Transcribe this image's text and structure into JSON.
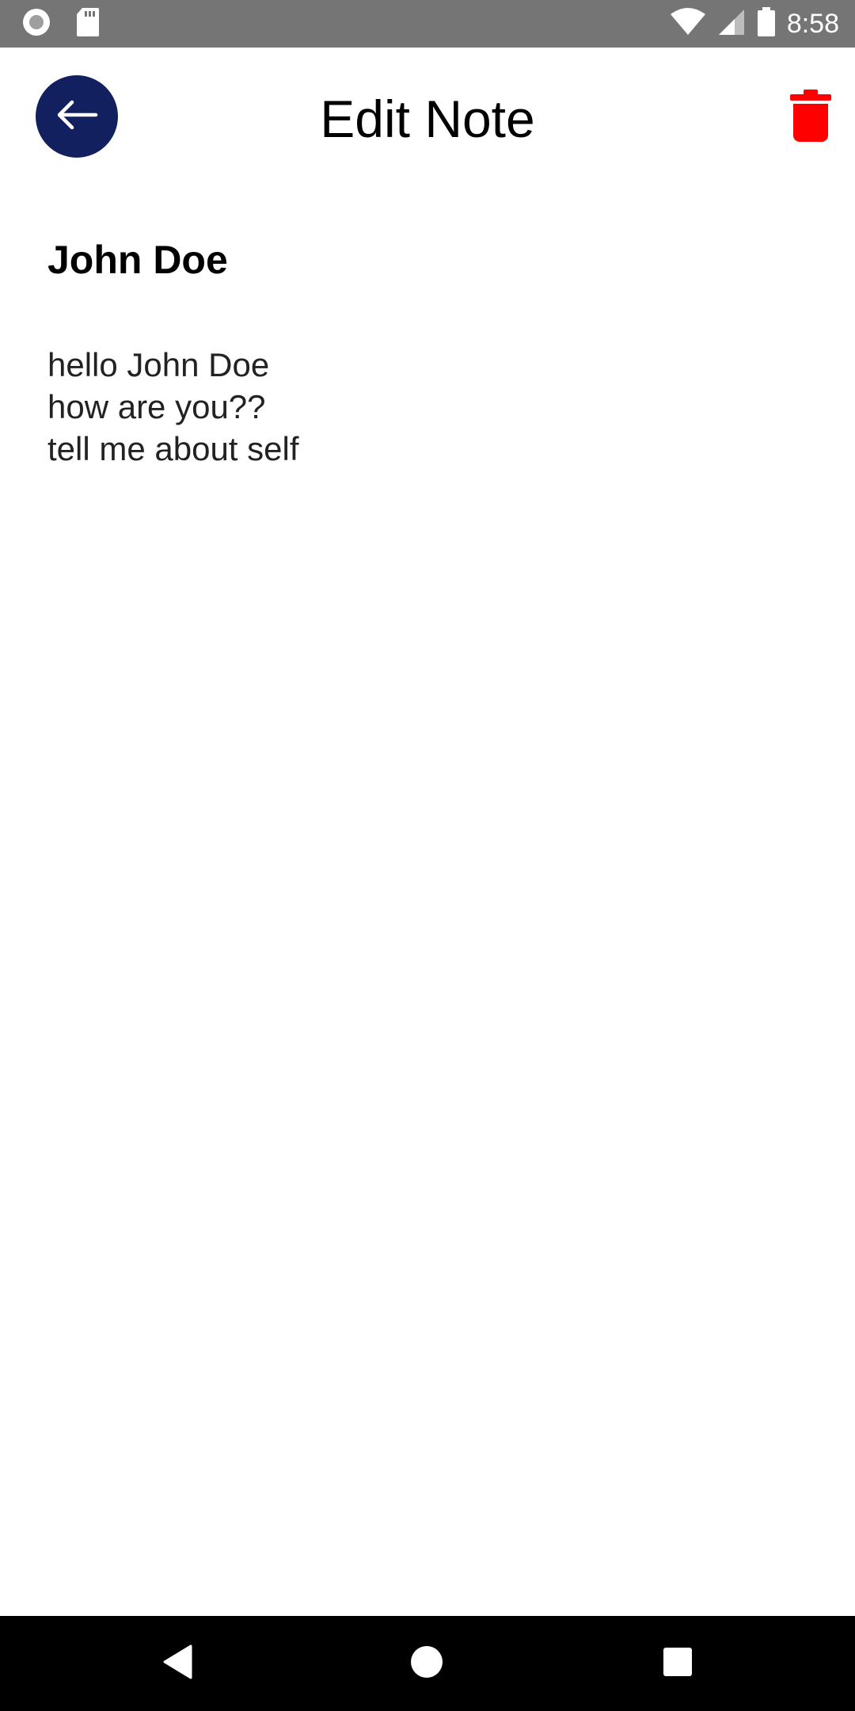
{
  "status_bar": {
    "time": "8:58",
    "icons": [
      "record-icon",
      "sd-card-icon",
      "wifi-icon",
      "signal-icon",
      "battery-icon"
    ]
  },
  "header": {
    "title": "Edit Note",
    "back_icon": "arrow-left-icon",
    "delete_icon": "trash-icon",
    "accent_color": "#12205f",
    "delete_color": "#ff0000"
  },
  "note": {
    "title": "John Doe",
    "lines": [
      "hello John Doe",
      "how are you??",
      "tell me about self"
    ]
  },
  "nav_bar": {
    "icons": [
      "back-triangle-icon",
      "home-circle-icon",
      "recents-square-icon"
    ]
  }
}
